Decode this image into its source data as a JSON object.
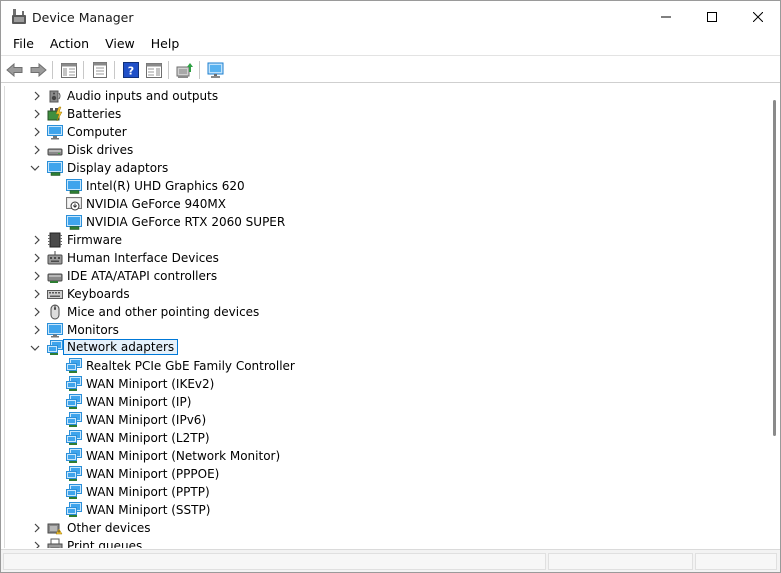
{
  "window": {
    "title": "Device Manager"
  },
  "menu": [
    {
      "label": "File"
    },
    {
      "label": "Action"
    },
    {
      "label": "View"
    },
    {
      "label": "Help"
    }
  ],
  "toolbar": {
    "buttons": [
      {
        "icon": "back-arrow-icon"
      },
      {
        "icon": "forward-arrow-icon"
      },
      {
        "icon": "show-hide-console-tree-icon"
      },
      {
        "icon": "properties-icon"
      },
      {
        "icon": "help-icon"
      },
      {
        "icon": "action-pane-icon"
      },
      {
        "icon": "update-driver-icon"
      },
      {
        "icon": "scan-hardware-icon"
      }
    ]
  },
  "tree": {
    "items": [
      {
        "label": "Audio inputs and outputs",
        "level": 0,
        "expanded": false,
        "icon": "speaker-icon"
      },
      {
        "label": "Batteries",
        "level": 0,
        "expanded": false,
        "icon": "battery-icon"
      },
      {
        "label": "Computer",
        "level": 0,
        "expanded": false,
        "icon": "computer-icon"
      },
      {
        "label": "Disk drives",
        "level": 0,
        "expanded": false,
        "icon": "disk-drive-icon"
      },
      {
        "label": "Display adaptors",
        "level": 0,
        "expanded": true,
        "icon": "display-adapter-icon"
      },
      {
        "label": "Intel(R) UHD Graphics 620",
        "level": 1,
        "icon": "display-adapter-icon"
      },
      {
        "label": "NVIDIA GeForce 940MX",
        "level": 1,
        "icon": "disabled-device-icon"
      },
      {
        "label": "NVIDIA GeForce RTX 2060 SUPER",
        "level": 1,
        "icon": "display-adapter-icon"
      },
      {
        "label": "Firmware",
        "level": 0,
        "expanded": false,
        "icon": "firmware-icon"
      },
      {
        "label": "Human Interface Devices",
        "level": 0,
        "expanded": false,
        "icon": "hid-icon"
      },
      {
        "label": "IDE ATA/ATAPI controllers",
        "level": 0,
        "expanded": false,
        "icon": "ide-controller-icon"
      },
      {
        "label": "Keyboards",
        "level": 0,
        "expanded": false,
        "icon": "keyboard-icon"
      },
      {
        "label": "Mice and other pointing devices",
        "level": 0,
        "expanded": false,
        "icon": "mouse-icon"
      },
      {
        "label": "Monitors",
        "level": 0,
        "expanded": false,
        "icon": "monitor-icon"
      },
      {
        "label": "Network adapters",
        "level": 0,
        "expanded": true,
        "selected": true,
        "icon": "network-adapter-icon"
      },
      {
        "label": "Realtek PCIe GbE Family Controller",
        "level": 1,
        "icon": "network-adapter-icon"
      },
      {
        "label": "WAN Miniport (IKEv2)",
        "level": 1,
        "icon": "network-adapter-icon"
      },
      {
        "label": "WAN Miniport (IP)",
        "level": 1,
        "icon": "network-adapter-icon"
      },
      {
        "label": "WAN Miniport (IPv6)",
        "level": 1,
        "icon": "network-adapter-icon"
      },
      {
        "label": "WAN Miniport (L2TP)",
        "level": 1,
        "icon": "network-adapter-icon"
      },
      {
        "label": "WAN Miniport (Network Monitor)",
        "level": 1,
        "icon": "network-adapter-icon"
      },
      {
        "label": "WAN Miniport (PPPOE)",
        "level": 1,
        "icon": "network-adapter-icon"
      },
      {
        "label": "WAN Miniport (PPTP)",
        "level": 1,
        "icon": "network-adapter-icon"
      },
      {
        "label": "WAN Miniport (SSTP)",
        "level": 1,
        "icon": "network-adapter-icon"
      },
      {
        "label": "Other devices",
        "level": 0,
        "expanded": false,
        "icon": "other-device-icon"
      },
      {
        "label": "Print queues",
        "level": 0,
        "expanded": false,
        "icon": "printer-icon"
      }
    ]
  },
  "colors": {
    "selection_border": "#0078d7",
    "selection_fill": "#e5f1fb",
    "monitor_blue": "#2b8fd8"
  }
}
